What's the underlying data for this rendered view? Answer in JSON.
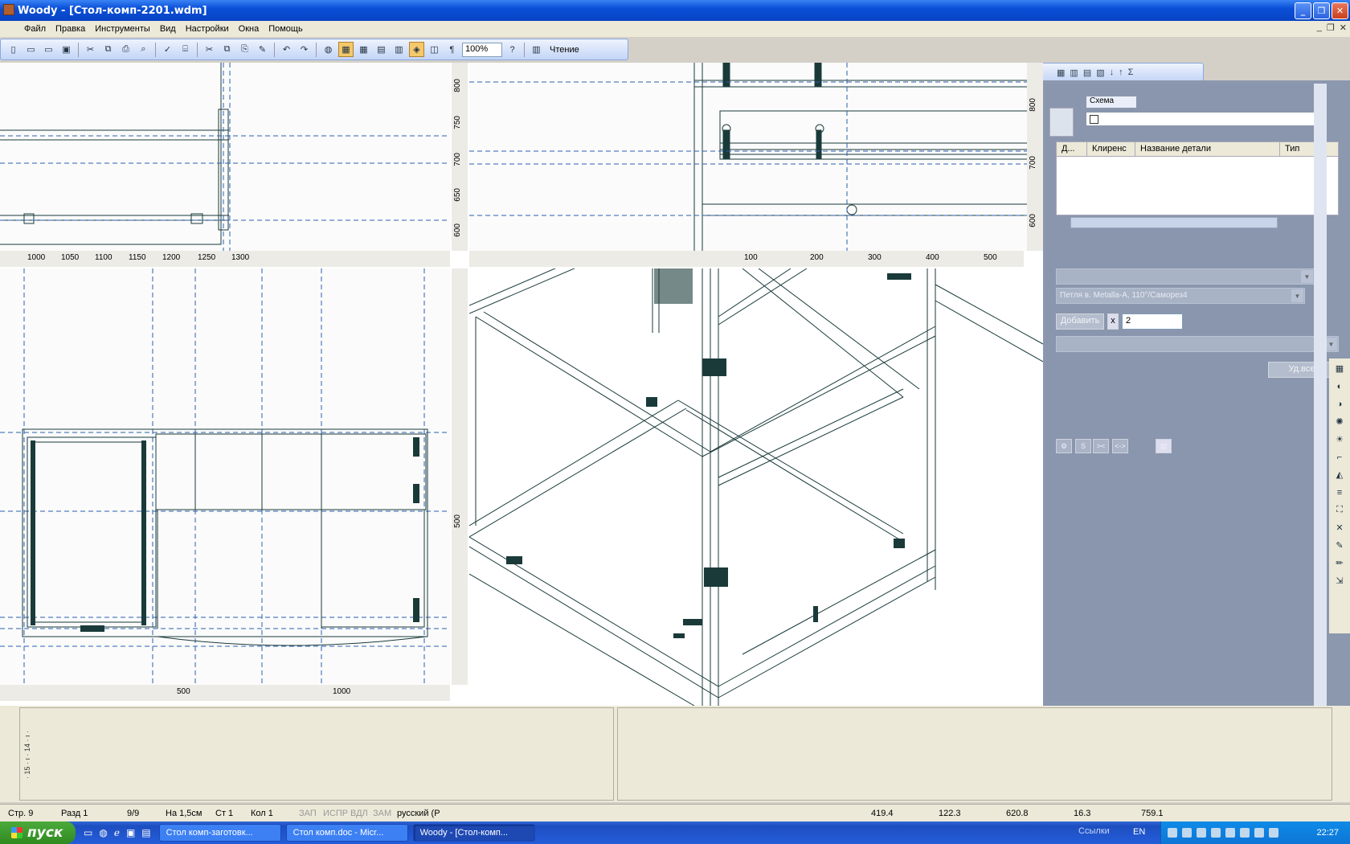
{
  "window": {
    "title": "Woody - [Стол-комп-2201.wdm]",
    "buttons": [
      "_",
      "❐",
      "✕"
    ]
  },
  "menu": {
    "items": [
      "Файл",
      "Правка",
      "Инструменты",
      "Вид",
      "Настройки",
      "Окна",
      "Помощь"
    ],
    "mdi_buttons": [
      "_",
      "❐",
      "✕"
    ]
  },
  "toolbar": {
    "zoom": "100%",
    "reading_label": "Чтение"
  },
  "rulers": {
    "top_left": [
      "1000",
      "1050",
      "1100",
      "1150",
      "1200",
      "1250",
      "1300"
    ],
    "top_left_vertical": [
      "800",
      "750",
      "700",
      "650",
      "600"
    ],
    "top_right": [
      "100",
      "200",
      "300",
      "400",
      "500"
    ],
    "top_right_vertical": [
      "800",
      "700",
      "600"
    ],
    "bottom_left": [
      "500",
      "1000"
    ],
    "bottom_left_vertical": [
      "500"
    ]
  },
  "right_panel": {
    "schema_label": "Схема",
    "table_headers": [
      "Д...",
      "Клиренс",
      "Название детали",
      "Тип"
    ],
    "combo_hinge": "Петля в. Metalla-A, 110°/Саморез4",
    "add_button": "Добавить",
    "times_label": "x",
    "quantity": "2",
    "delete_all_button": "Уд.все",
    "small_buttons": [
      "S",
      "><",
      "<->"
    ]
  },
  "bottom": {
    "vertical_ruler": "· 15 · ı · 14 · ı ·"
  },
  "status": {
    "page": "Стр. 9",
    "section": "Разд 1",
    "pages": "9/9",
    "at": "На 1,5см",
    "line": "Ст 1",
    "col": "Кол 1",
    "rec": "ЗАП",
    "trk": "ИСПР",
    "ext": "ВДЛ",
    "ovr": "ЗАМ",
    "lang": "русский (Р",
    "coords": [
      "419.4",
      "122.3",
      "620.8",
      "16.3",
      "759.1"
    ]
  },
  "taskbar": {
    "start": "пуск",
    "tasks": [
      "Стол комп-заготовк...",
      "Стол комп.doc - Micr...",
      "Woody - [Стол-комп..."
    ],
    "links": "Ссылки",
    "lang": "EN",
    "clock": "22:27"
  }
}
